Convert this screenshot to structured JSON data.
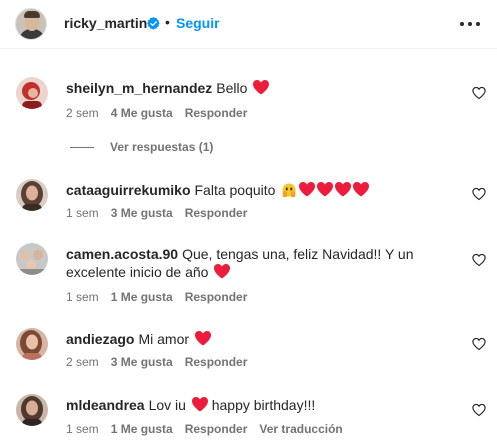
{
  "header": {
    "username": "ricky_martin",
    "separator": "•",
    "follow_label": "Seguir"
  },
  "comments": [
    {
      "username": "sheilyn_m_hernandez",
      "text": "Bello",
      "time": "2 sem",
      "likes": "4 Me gusta",
      "reply": "Responder",
      "avatar_color": "#b3322f"
    },
    {
      "username": "cataaguirrekumiko",
      "text": "Falta poquito",
      "time": "1 sem",
      "likes": "3 Me gusta",
      "reply": "Responder",
      "avatar_color": "#6b5446"
    },
    {
      "username": "camen.acosta.90",
      "text": "Que, tengas una, feliz Navidad!! Y un excelente inicio de año",
      "time": "1 sem",
      "likes": "1 Me gusta",
      "reply": "Responder",
      "avatar_color": "#9aa0a4"
    },
    {
      "username": "andiezago",
      "text": "Mi amor",
      "time": "2 sem",
      "likes": "3 Me gusta",
      "reply": "Responder",
      "avatar_color": "#a06a56"
    },
    {
      "username": "mldeandrea",
      "text": "Lov iu",
      "text_after": "happy birthday!!!",
      "time": "1 sem",
      "likes": "1 Me gusta",
      "reply": "Responder",
      "translate": "Ver traducción",
      "avatar_color": "#5e4a3f"
    }
  ],
  "view_replies": "Ver respuestas (1)",
  "colors": {
    "link_blue": "#0095f6",
    "heart_red": "#ed1c3c",
    "meta_gray": "#737373",
    "text": "#262626"
  },
  "icons": {
    "verified": "verified-badge-icon",
    "more": "more-options-icon",
    "like": "heart-outline-icon",
    "heart_emoji": "red-heart-emoji",
    "hands_emoji": "face-holding-back-tears-emoji"
  }
}
